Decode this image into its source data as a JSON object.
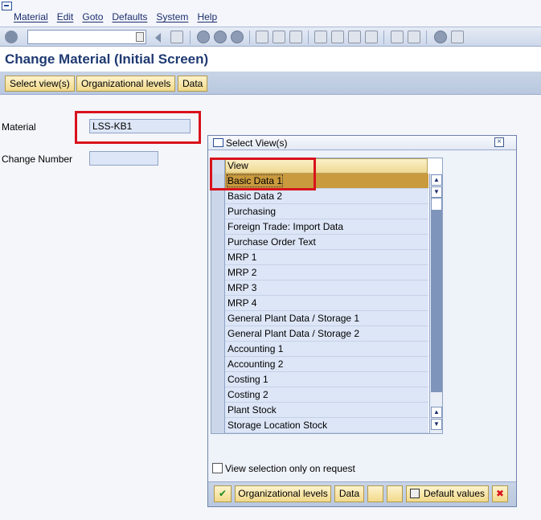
{
  "menu": {
    "items": [
      "Material",
      "Edit",
      "Goto",
      "Defaults",
      "System",
      "Help"
    ]
  },
  "toolbar": {
    "command_field_value": "",
    "icons": [
      "enter-icon",
      "back-icon",
      "save-icon",
      "back-nav-icon",
      "exit-icon",
      "cancel-icon",
      "print-icon",
      "find-icon",
      "find-next-icon",
      "first-page-icon",
      "previous-page-icon",
      "next-page-icon",
      "last-page-icon",
      "new-session-icon",
      "shortcut-icon",
      "help-icon",
      "layout-icon"
    ]
  },
  "page": {
    "title": "Change Material (Initial Screen)"
  },
  "app_toolbar": {
    "select_views": "Select view(s)",
    "org_levels": "Organizational levels",
    "data": "Data"
  },
  "form": {
    "material_label": "Material",
    "material_value": "LSS-KB1",
    "change_number_label": "Change Number",
    "change_number_value": ""
  },
  "dialog": {
    "title": "Select View(s)",
    "close_label": "×",
    "column_header": "View",
    "views": [
      "Basic Data 1",
      "Basic Data 2",
      "Purchasing",
      "Foreign Trade: Import Data",
      "Purchase Order Text",
      "MRP 1",
      "MRP 2",
      "MRP 3",
      "MRP 4",
      "General Plant Data / Storage 1",
      "General Plant Data / Storage 2",
      "Accounting 1",
      "Accounting 2",
      "Costing 1",
      "Costing 2",
      "Plant Stock",
      "Storage Location Stock"
    ],
    "selected_view": "Basic Data 1",
    "checkbox_label": "View selection only on request",
    "footer": {
      "org_levels": "Organizational levels",
      "data": "Data",
      "default_values": "Default values",
      "icons": [
        "continue-check-icon",
        "select-all-icon",
        "deselect-all-icon",
        "save-default-icon",
        "cancel-x-icon"
      ]
    }
  },
  "colors": {
    "highlight_box": "#d8121c",
    "selected_row": "#c99a3e",
    "title_color": "#1f3a72"
  }
}
